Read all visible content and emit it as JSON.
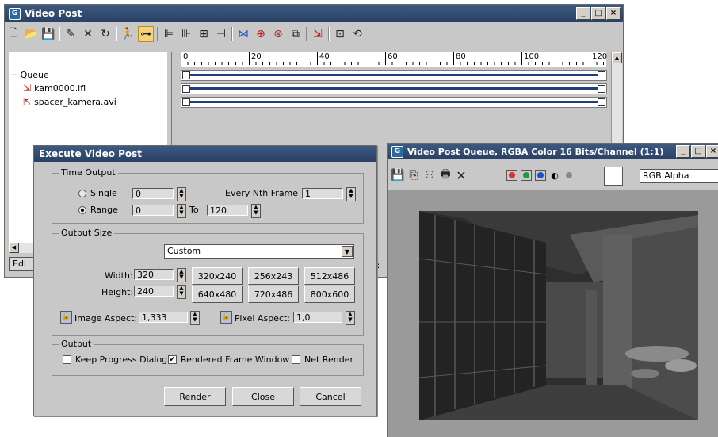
{
  "vp": {
    "title": "Video Post",
    "queue_label": "Queue",
    "items": [
      "kam0000.ifl",
      "spacer_kamera.avi"
    ],
    "ruler_ticks": [
      "0",
      "20",
      "40",
      "60",
      "80",
      "100",
      "120"
    ],
    "edit_partial": "Edi",
    "right_partial": "F:"
  },
  "exec": {
    "title": "Execute Video Post",
    "time_output": {
      "label": "Time Output",
      "single_label": "Single",
      "single_value": "0",
      "every_nth_label": "Every Nth Frame",
      "every_nth_value": "1",
      "range_label": "Range",
      "range_from": "0",
      "to_label": "To",
      "range_to": "120",
      "selected": "Range"
    },
    "output_size": {
      "label": "Output Size",
      "preset": "Custom",
      "width_label": "Width:",
      "width_value": "320",
      "height_label": "Height:",
      "height_value": "240",
      "presets": [
        "320x240",
        "256x243",
        "512x486",
        "640x480",
        "720x486",
        "800x600"
      ],
      "image_aspect_label": "Image Aspect:",
      "image_aspect_value": "1,333",
      "pixel_aspect_label": "Pixel Aspect:",
      "pixel_aspect_value": "1,0"
    },
    "output": {
      "label": "Output",
      "keep_progress_label": "Keep Progress Dialog",
      "keep_progress_checked": false,
      "rendered_frame_label": "Rendered Frame Window",
      "rendered_frame_checked": true,
      "net_render_label": "Net Render",
      "net_render_checked": false
    },
    "buttons": {
      "render": "Render",
      "close": "Close",
      "cancel": "Cancel"
    }
  },
  "queue": {
    "title": "Video Post Queue, RGBA Color 16 Bits/Channel (1:1)",
    "channel": "RGB Alpha",
    "channel_colors": {
      "red": "#e03030",
      "green": "#1e9a40",
      "blue": "#1e50c8"
    }
  },
  "icons": {
    "vp_toolbar": [
      "new-icon",
      "open-icon",
      "save-icon",
      "edit-icon",
      "delete-icon",
      "swap-icon",
      "execute-icon",
      "edit-range-bar-icon",
      "align-left-icon",
      "align-right-icon",
      "same-size-icon",
      "abut-icon",
      "add-scene-icon",
      "add-image-input-icon",
      "add-image-filter-icon",
      "add-layer-icon",
      "add-image-output-icon",
      "add-external-icon",
      "add-loop-icon"
    ],
    "queue_toolbar": [
      "save-image-icon",
      "clone-icon",
      "track-icon",
      "print-icon",
      "clear-icon"
    ]
  }
}
